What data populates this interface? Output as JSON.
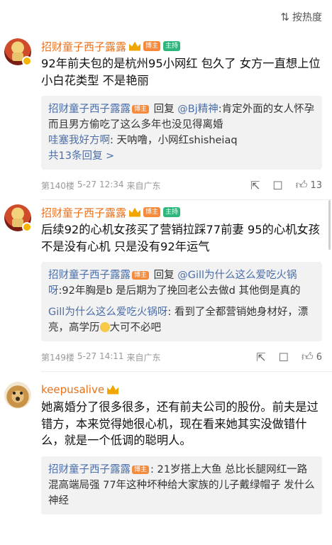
{
  "sort": {
    "icon": "sort-lines-icon",
    "label": "按热度"
  },
  "comments": [
    {
      "username": "招财童子西子露露",
      "tags": [
        "博主",
        "主持"
      ],
      "text": "92年前夫包的是杭州95小网红 包久了 女方一直想上位 小白花类型 不是艳丽",
      "replies": [
        {
          "name": "招财童子西子露露",
          "tag": "博主",
          "prefix": " 回复 ",
          "mention": "@Bj精神",
          "content": ":肯定外面的女人怀孕 而且男方偷吃了这么多年也没见得离婚"
        },
        {
          "name": "哇塞我好方啊",
          "content": ": 天呐噜，小网红shisheiaq"
        }
      ],
      "more": "共13条回复 >",
      "meta": {
        "floor": "第140楼",
        "date": "5-27 12:34",
        "location": "来自广东",
        "likes": "13"
      }
    },
    {
      "username": "招财童子西子露露",
      "tags": [
        "博主",
        "主持"
      ],
      "text": "后续92的心机女孩买了营销拉踩77前妻  95的心机女孩不是没有心机 只是没有92年运气",
      "replies": [
        {
          "name": "招财童子西子露露",
          "tag": "博主",
          "prefix": " 回复 ",
          "mention": "@Gill为什么这么爱吃火锅呀",
          "content": ":92年胸是b 是后期为了挽回老公去做d 其他倒是真的"
        },
        {
          "name": "Gill为什么这么爱吃火锅呀",
          "content": ": 看到了全都营销她身材好，漂亮，高学历",
          "tail": "大可不必吧"
        }
      ],
      "meta": {
        "floor": "第149楼",
        "date": "5-27 14:11",
        "location": "来自广东",
        "likes": "6"
      }
    },
    {
      "username": "keepusalive",
      "text": "她离婚分了很多很多，还有前夫公司的股份。前夫是过错方，本来觉得她很心机，现在看来她其实没做错什么，就是一个低调的聪明人。",
      "replies": [
        {
          "name": "招财童子西子露露",
          "tag": "博主",
          "content": ": 21岁搭上大鱼 总比长腿网红一路混高端局强 77年这种坏种给大家族的儿子戴绿帽子 发什么神经"
        }
      ]
    }
  ]
}
